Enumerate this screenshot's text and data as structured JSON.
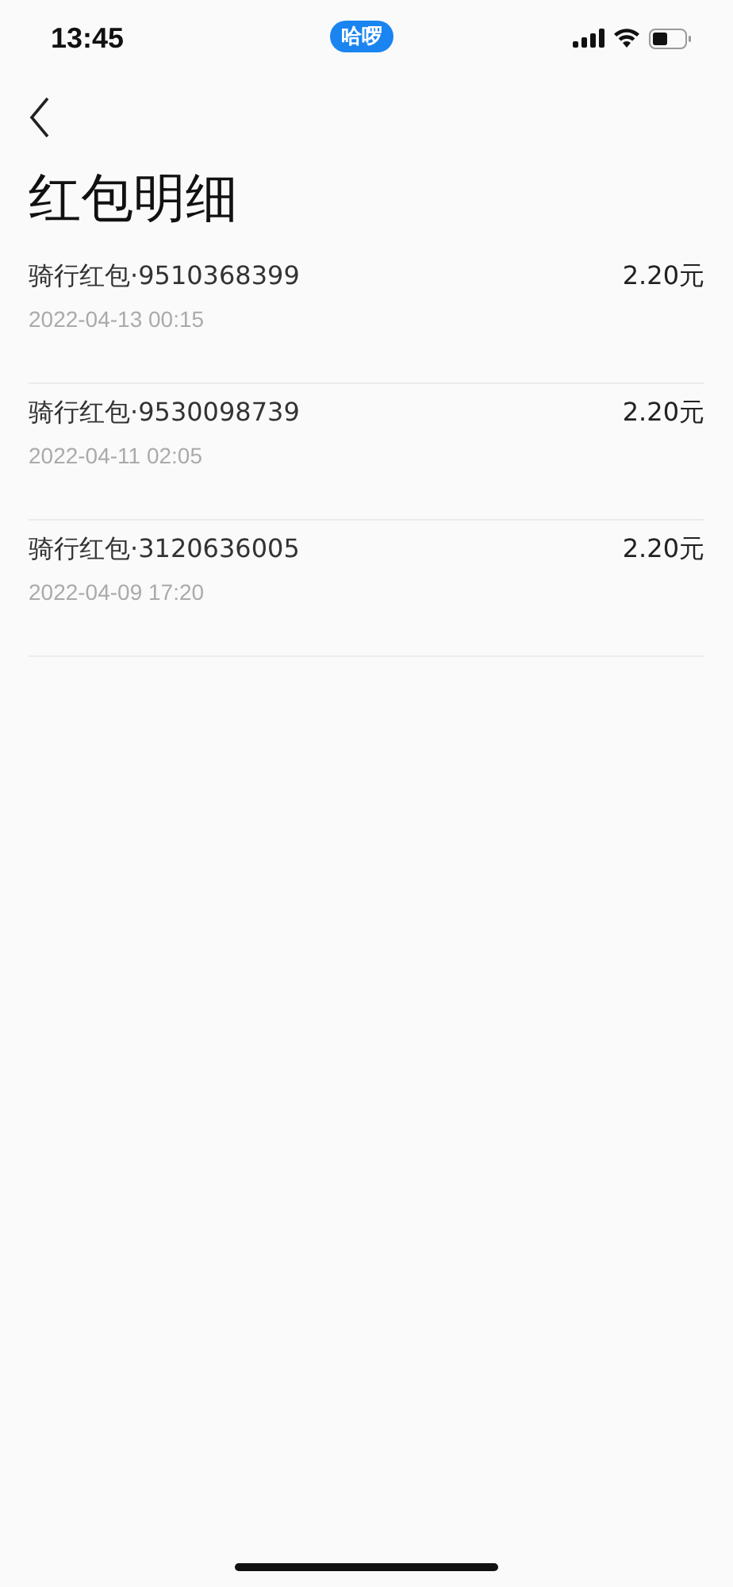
{
  "status_bar": {
    "time": "13:45",
    "app_pill": "哈啰"
  },
  "title": "红包明细",
  "records": [
    {
      "name": "骑行红包·9510368399",
      "time": "2022-04-13 00:15",
      "amount": "2.20元"
    },
    {
      "name": "骑行红包·9530098739",
      "time": "2022-04-11 02:05",
      "amount": "2.20元"
    },
    {
      "name": "骑行红包·3120636005",
      "time": "2022-04-09 17:20",
      "amount": "2.20元"
    }
  ]
}
